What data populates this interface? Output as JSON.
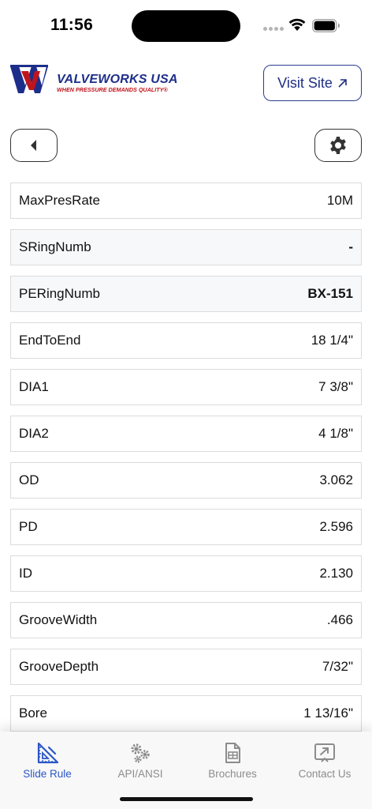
{
  "status_bar": {
    "time": "11:56",
    "icons": [
      "signal-dots-icon",
      "wifi-icon",
      "battery-icon"
    ]
  },
  "header": {
    "logo_name": "VALVEWORKS USA",
    "logo_tagline": "WHEN PRESSURE DEMANDS QUALITY®",
    "visit_site_label": "Visit Site",
    "visit_site_icon": "arrow-up-right-icon"
  },
  "toolbar": {
    "back_icon": "caret-left-icon",
    "settings_icon": "gear-icon"
  },
  "specs": [
    {
      "label": "MaxPresRate",
      "value": "10M"
    },
    {
      "label": "SRingNumb",
      "value": "-"
    },
    {
      "label": "PERingNumb",
      "value": "BX-151"
    },
    {
      "label": "EndToEnd",
      "value": "18 1/4\""
    },
    {
      "label": "DIA1",
      "value": "7 3/8\""
    },
    {
      "label": "DIA2",
      "value": "4 1/8\""
    },
    {
      "label": "OD",
      "value": "3.062"
    },
    {
      "label": "PD",
      "value": "2.596"
    },
    {
      "label": "ID",
      "value": "2.130"
    },
    {
      "label": "GrooveWidth",
      "value": ".466"
    },
    {
      "label": "GrooveDepth",
      "value": "7/32\""
    },
    {
      "label": "Bore",
      "value": "1 13/16\""
    }
  ],
  "tabs": [
    {
      "label": "Slide Rule",
      "icon": "triangle-ruler-icon",
      "active": true
    },
    {
      "label": "API/ANSI",
      "icon": "gears-icon",
      "active": false
    },
    {
      "label": "Brochures",
      "icon": "document-icon",
      "active": false
    },
    {
      "label": "Contact Us",
      "icon": "share-box-icon",
      "active": false
    }
  ],
  "colors": {
    "brand_blue": "#1d2e8a",
    "brand_red": "#c0141c",
    "active_tab": "#2a56c6",
    "inactive_tab": "#8c8c8c"
  }
}
